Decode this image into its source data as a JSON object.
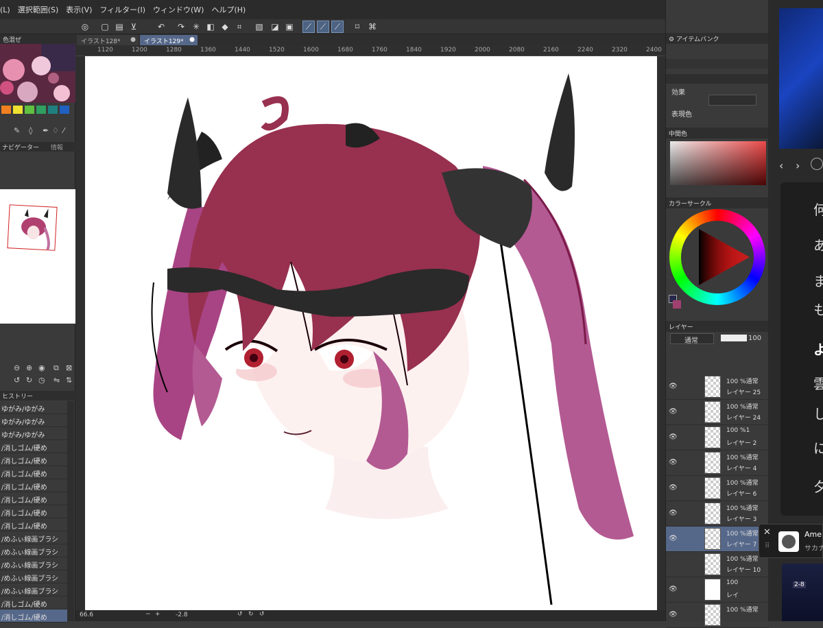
{
  "menu": [
    "(L)",
    "選択範囲(S)",
    "表示(V)",
    "フィルター(I)",
    "ウィンドウ(W)",
    "ヘルプ(H)"
  ],
  "tabs": [
    {
      "label": "イラスト128*"
    },
    {
      "label": "イラスト129*"
    }
  ],
  "left": {
    "color_mix_label": "色混ぜ",
    "navigator_label": "ナビゲーター",
    "info_label": "情報",
    "history_label": "ヒストリー",
    "history": [
      "ゆがみ/ゆがみ",
      "ゆがみ/ゆがみ",
      "ゆがみ/ゆがみ",
      "/消しゴム/硬め",
      "/消しゴム/硬め",
      "/消しゴム/硬め",
      "/消しゴム/硬め",
      "/消しゴム/硬め",
      "/消しゴム/硬め",
      "/消しゴム/硬め",
      "/めふぃ線画ブラシ",
      "/めふぃ線画ブラシ",
      "/めふぃ線画ブラシ",
      "/めふぃ線画ブラシ",
      "/めふぃ線画ブラシ",
      "/消しゴム/硬め",
      "/消しゴム/硬め"
    ]
  },
  "ruler": {
    "top": [
      "1120",
      "1200",
      "1280",
      "1360",
      "1440",
      "1520",
      "1600",
      "1680",
      "1760",
      "1840",
      "1920",
      "2000",
      "2080",
      "2160",
      "2240",
      "2320",
      "2400"
    ]
  },
  "status": {
    "zoom": "66.6",
    "rotation": "-2.8"
  },
  "right": {
    "item_bank": "アイテムバンク",
    "effects": "効果",
    "expression_color": "表現色",
    "intermediate_color": "中間色",
    "color_circle": "カラーサークル",
    "layer_panel": "レイヤー",
    "blend_mode": "通常",
    "opacity": "100",
    "layers": [
      {
        "pct": "100 %通常",
        "name": "レイヤー 25"
      },
      {
        "pct": "100 %通常",
        "name": "レイヤー 24"
      },
      {
        "pct": "100 %1",
        "name": "レイヤー 2"
      },
      {
        "pct": "100 %通常",
        "name": "レイヤー 4"
      },
      {
        "pct": "100 %通常",
        "name": "レイヤー 6"
      },
      {
        "pct": "100 %通常",
        "name": "レイヤー 3"
      },
      {
        "pct": "100 %通常",
        "name": "レイヤー 7"
      },
      {
        "pct": "100 %通常",
        "name": "レイヤー 10"
      },
      {
        "pct": "100",
        "name": "レイ"
      },
      {
        "pct": "100 %通常",
        "name": ""
      }
    ]
  },
  "notification": {
    "title": "Ame",
    "subtitle": "サカナ"
  },
  "third_panel": {
    "chars": [
      "何",
      "あ",
      "ま",
      "も",
      "よ",
      "雲",
      "し",
      "に",
      "夕"
    ],
    "badge": "2-8"
  }
}
